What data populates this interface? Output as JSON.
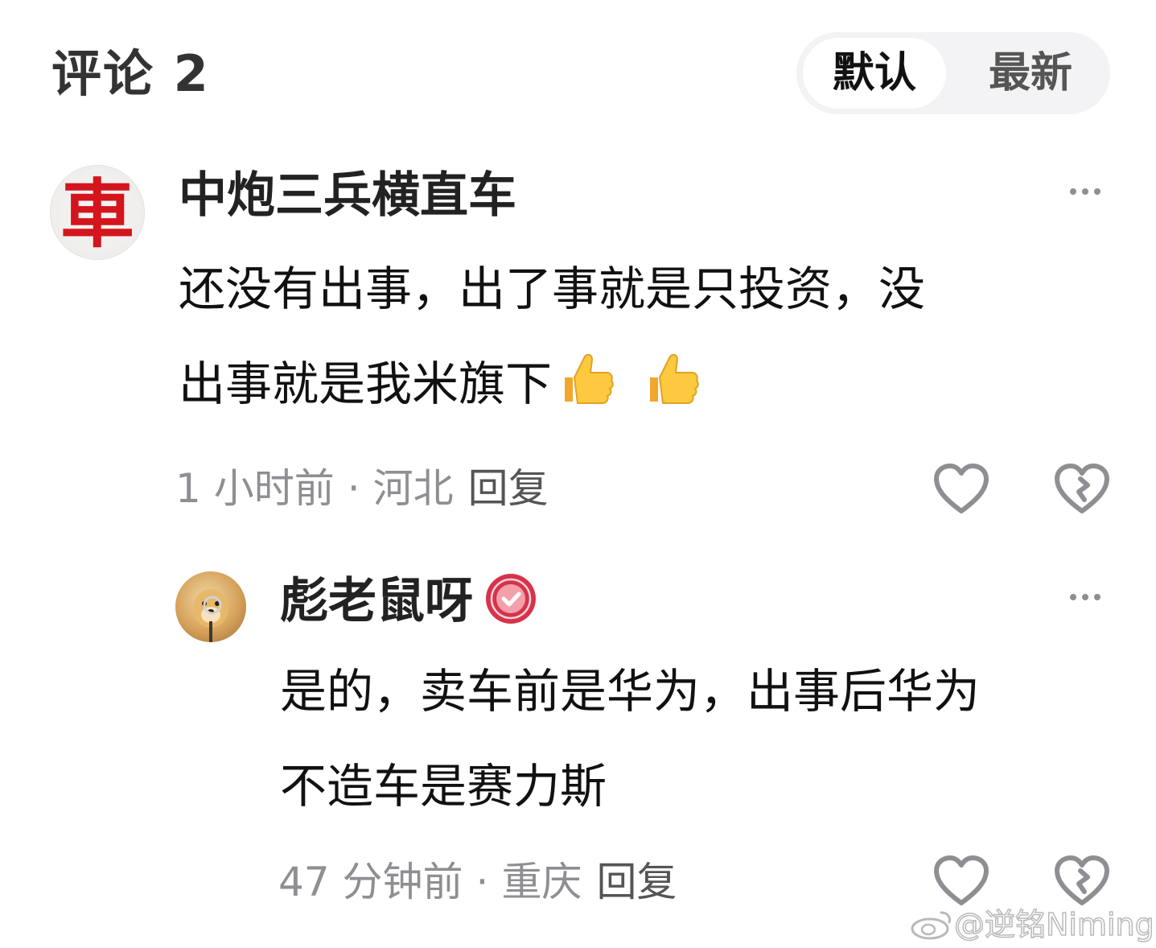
{
  "header": {
    "title": "评论 2",
    "sort_options": [
      "默认",
      "最新"
    ],
    "active_sort": "默认"
  },
  "comments": [
    {
      "avatar_glyph": "車",
      "username": "中炮三兵横直车",
      "text_line1": "还没有出事，出了事就是只投资，没",
      "text_line2": "出事就是我米旗下",
      "time": "1 小时前",
      "location": "河北",
      "reply_label": "回复",
      "emoji": [
        "thumbs-up",
        "thumbs-up"
      ]
    },
    {
      "username": "彪老鼠呀",
      "verified_badge": true,
      "text_line1": "是的，卖车前是华为，出事后华为",
      "text_line2": "不造车是赛力斯",
      "time": "47 分钟前",
      "location": "重庆",
      "reply_label": "回复"
    }
  ],
  "meta_separator": "·",
  "watermark": "@逆铭Niming",
  "colors": {
    "text_primary": "#111111",
    "text_secondary": "#8e8e93",
    "badge_red": "#d6334a",
    "avatar_glyph_red": "#d4151d",
    "toggle_bg": "#f3f3f5"
  }
}
